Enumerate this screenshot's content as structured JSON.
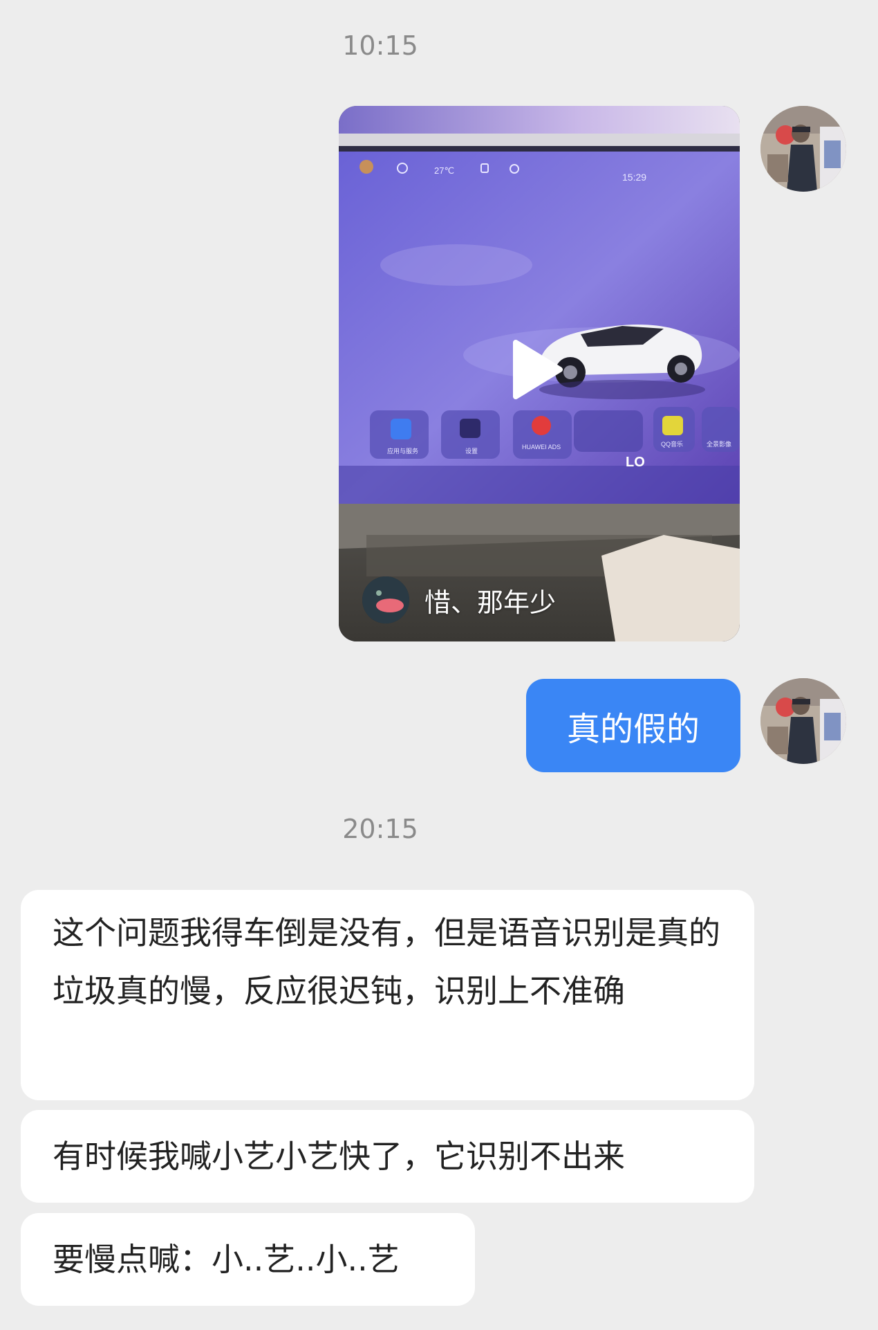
{
  "chat": {
    "timestamp_1": "10:15",
    "timestamp_2": "20:15",
    "video": {
      "author_name": "惜、那年少",
      "screen_time": "15:29",
      "screen_temp": "27℃",
      "climate_label": "LO",
      "dock_labels": [
        "应用与服务",
        "设置",
        "HUAWEI ADS",
        "QQ音乐",
        "全景影像"
      ]
    },
    "outgoing": {
      "text": "真的假的"
    },
    "incoming": [
      {
        "text": "这个问题我得车倒是没有，但是语音识别是真的垃圾真的慢，反应很迟钝，识别上不准确"
      },
      {
        "text": "有时候我喊小艺小艺快了，它识别不出来"
      },
      {
        "text": "要慢点喊：小..艺..小..艺"
      }
    ]
  },
  "colors": {
    "background": "#ededed",
    "outgoing_bubble": "#3a86f5",
    "incoming_bubble": "#ffffff",
    "timestamp": "#8a8a8a"
  }
}
